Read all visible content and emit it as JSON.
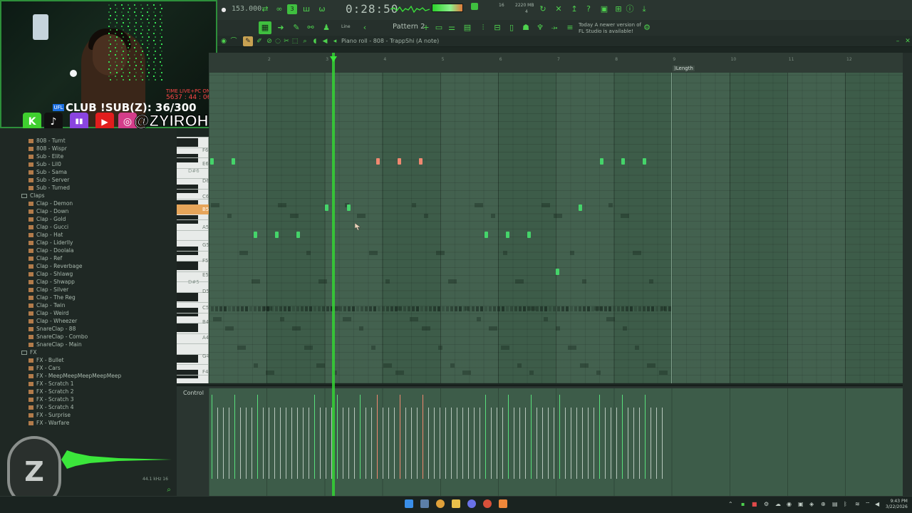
{
  "toolbar": {
    "bpm": "153.000",
    "time": "0:28:50",
    "pattern": "Pattern 2",
    "snap": "Line",
    "memory": "2220 MB",
    "voices": "16",
    "cpu_val": "4",
    "update_notice_line1": "Today  A newer version of",
    "update_notice_line2": "FL Studio is available!",
    "pianoroll_title": "Piano roll - 808 - TrappShi (A note)"
  },
  "stream": {
    "time_live_label": "TIME LIVE+PC ON",
    "time_live_value": "5637 : 44 : 06",
    "sub_goal": "CLUB !SUB(Z): 36/300",
    "ufl_badge": "UFL",
    "handle": "@ZYIROH",
    "social_k": "K",
    "social_tiktok": "♪",
    "social_twitch": "▮▮",
    "social_youtube": "▶",
    "social_ig": "◎"
  },
  "browser": {
    "items_808": [
      "808 - Turnt",
      "808 - Wispr",
      "Sub - Elite",
      "Sub - Lil0",
      "Sub - Sama",
      "Sub - Server",
      "Sub - Turned"
    ],
    "folder_claps": "Claps",
    "claps": [
      "Clap - Demon",
      "Clap - Down",
      "Clap - Gold",
      "Clap - Gucci",
      "Clap - Hat",
      "Clap - Liderlly",
      "Clap - Doolala",
      "Clap - Ref",
      "Clap - Reverbage",
      "Clap - Shlawg",
      "Clap - Shwapp",
      "Clap - Silver",
      "Clap - The Reg",
      "Clap - Twin",
      "Clap - Weird",
      "Clap - Wheezer",
      "SnareClap - 88",
      "SnareClap - Combo",
      "SnareClap - Main"
    ],
    "folder_fx": "FX",
    "fx": [
      "FX - Bullet",
      "FX - Cars",
      "FX - MeepMeepMeepMeepMeep",
      "FX - Scratch 1",
      "FX - Scratch 2",
      "FX - Scratch 3",
      "FX - Scratch 4",
      "FX - Surprise",
      "FX - Warfare"
    ],
    "sample_rate": "44.1 kHz 16"
  },
  "keyboard": {
    "labels": [
      "F6",
      "E6",
      "D#6",
      "D6",
      "C6",
      "B5",
      "A5",
      "G5",
      "F5",
      "E5",
      "D#5",
      "D5",
      "C5",
      "B4",
      "A4",
      "G4",
      "F4"
    ],
    "highlight": "B5"
  },
  "ruler": {
    "marks": [
      "2",
      "3",
      "4",
      "5",
      "6",
      "7",
      "8",
      "9",
      "10",
      "11",
      "12"
    ],
    "length_label": ")Length"
  },
  "control": {
    "label": "Control"
  },
  "logo": {
    "text": "Z"
  },
  "clock": {
    "time": "9:43 PM",
    "date": "3/22/2026"
  }
}
